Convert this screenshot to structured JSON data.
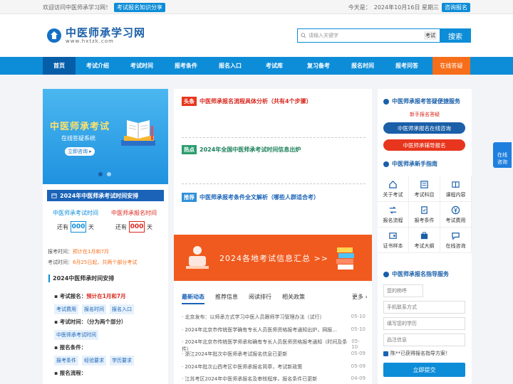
{
  "topbar": {
    "welcome": "欢迎访问中医师承学习网！",
    "share_tag": "考试报名知识分享",
    "date_prefix": "今天是：",
    "date": "2024年10月16日 星期三",
    "consult_tag": "咨询报名"
  },
  "logo": {
    "name": "中医师承学习网",
    "domain": "www.hxtzk.com"
  },
  "search": {
    "placeholder": "请输入关键字",
    "select": "考试",
    "button": "搜索"
  },
  "nav": {
    "items": [
      "首页",
      "考试介绍",
      "考试时间",
      "报考条件",
      "报名入口",
      "考试库",
      "复习备考",
      "报名时间",
      "报考问答"
    ],
    "qa": "在线答疑"
  },
  "banner": {
    "title": "中医师承考试",
    "subtitle": "在线答疑系统",
    "cta": "立即咨询 ▸"
  },
  "schedule": {
    "title": "2024年中医师承考试时间安排",
    "exam_label": "中医师承考试时间",
    "reg_label": "中医师承报名时间",
    "prefix": "还有",
    "exam_days": "000",
    "reg_days": "000",
    "unit": "天",
    "reg_time_label": "报考时间：",
    "reg_time": "预计在1月和7月",
    "exam_time_label": "考试时间：",
    "exam_time": "6月25日起，共两个部分考试"
  },
  "arrange": {
    "title": "2024中医师承时间安排",
    "reg_label": "考试报名：",
    "reg_value": "预计在1月和7月",
    "reg_chips": [
      "考试费用",
      "报名时间",
      "报名入口"
    ],
    "exam_label": "考试时间：（分为两个部分）",
    "exam_chips": [
      "中医师承考试时间"
    ],
    "cond_label": "报名条件：",
    "cond_chips": [
      "报考条件",
      "经验要求",
      "学历要求"
    ],
    "flow_label": "报名流程："
  },
  "headlines": [
    {
      "tag": "头条",
      "text": "中医师承报名流程具体分析（共有4个步骤）",
      "color": "#e8361e",
      "tcolor": "#d9281f"
    },
    {
      "tag": "热点",
      "text": "2024年全国中医师承考试时间信息出炉",
      "color": "#2a9d6e",
      "tcolor": "#1a7f5a"
    },
    {
      "tag": "推荐",
      "text": "中医师承报考条件全文解析（哪些人群适合考）",
      "color": "#2f8fd8",
      "tcolor": "#1a63b8"
    }
  ],
  "promo": {
    "text": "2024各地考试信息汇总 >>"
  },
  "tabs": [
    "最新动态",
    "推荐信息",
    "阅读排行",
    "相关政策"
  ],
  "more": "更多 ›",
  "newslist": [
    {
      "t": "· 北京发布：以师承方式学习中医人员跟师学习管理办法（试行）",
      "d": "05-10"
    },
    {
      "t": "· 2024年北京市传统医学确有专长人员医师资格报考通知出炉，网报...",
      "d": "05-10"
    },
    {
      "t": "· 2024年北京市传统医学师承和确有专长人员医师资格报考通知（时间及条件）",
      "d": "05-10"
    },
    {
      "t": "· 浙江2024年批次中医师承考试报名信息已更新",
      "d": "05-09"
    },
    {
      "t": "· 2024年批次山西考区中医师承报名简章，考试新政策",
      "d": "05-09"
    },
    {
      "t": "· 江苏考区2024年中医师承报名及审核程序，报名条件已更新",
      "d": "04-09"
    }
  ],
  "right": {
    "service_title": "中医师承报考答疑便捷服务",
    "service_sub": "新手报名答疑",
    "btn1": "中医师承报名在线咨询",
    "btn2": "中医师承辅导报名",
    "guide_title": "中医师承新手指南",
    "guide": [
      {
        "label": "关于考试",
        "icon": "home-icon"
      },
      {
        "label": "考试科目",
        "icon": "subject-icon"
      },
      {
        "label": "课程内容",
        "icon": "book-icon"
      },
      {
        "label": "报名流程",
        "icon": "flow-icon"
      },
      {
        "label": "报考条件",
        "icon": "condition-icon"
      },
      {
        "label": "考试费用",
        "icon": "fee-icon"
      },
      {
        "label": "证书样本",
        "icon": "certificate-icon"
      },
      {
        "label": "考试大纲",
        "icon": "outline-icon"
      },
      {
        "label": "在线咨询",
        "icon": "chat-icon"
      }
    ],
    "form_title": "中医师承报名指导服务",
    "name_ph": "您的称呼",
    "phone_ph": "手机联系方式",
    "edu_ph": "填写您的学历",
    "msg_ph": "品注信息",
    "note": "陈**已获得报名指导方案！",
    "submit": "立即提交"
  },
  "float": {
    "text1": "在线",
    "text2": "咨询"
  },
  "colors": {
    "primary": "#0d8dd8",
    "dark": "#1a5fa8",
    "orange": "#f66e1a",
    "red": "#d9281f"
  }
}
